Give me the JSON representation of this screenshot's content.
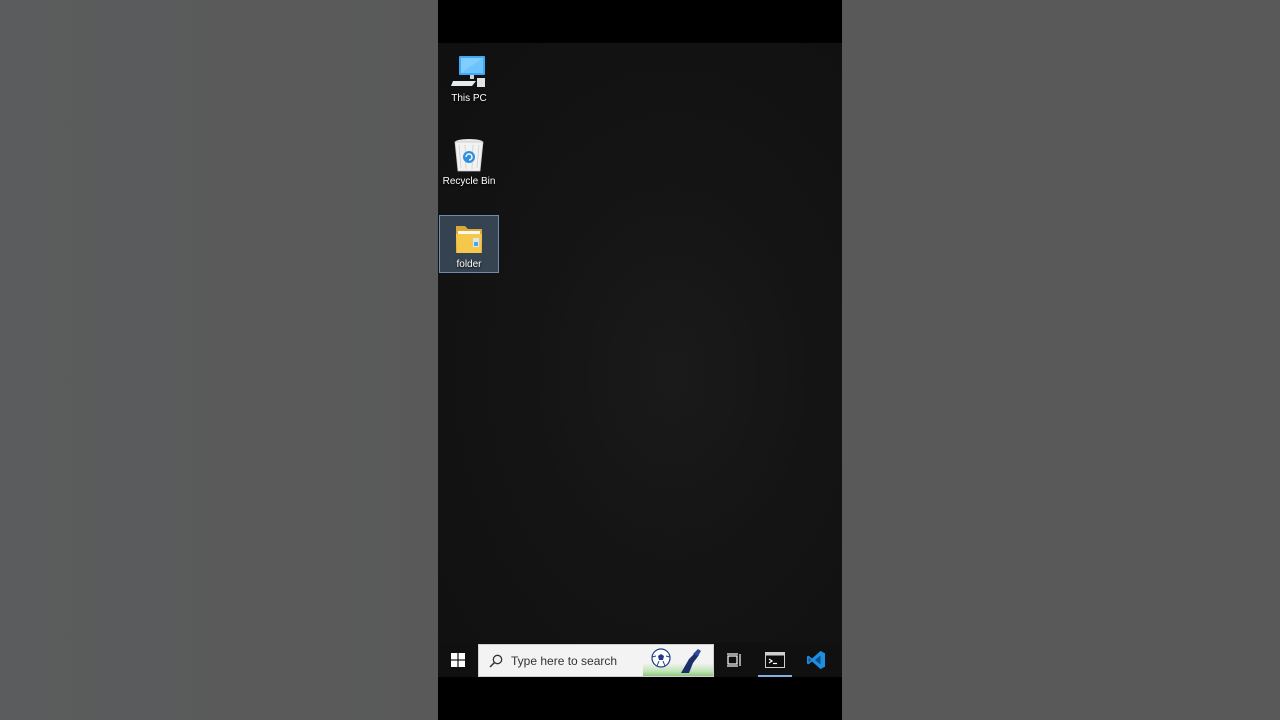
{
  "desktop": {
    "icons": [
      {
        "label": "This PC",
        "icon": "this-pc-icon"
      },
      {
        "label": "Recycle Bin",
        "icon": "recycle-bin-icon"
      },
      {
        "label": "folder",
        "icon": "folder-icon",
        "selected": true
      }
    ]
  },
  "taskbar": {
    "search": {
      "placeholder": "Type here to search",
      "value": ""
    },
    "buttons": [
      {
        "name": "start",
        "icon": "windows-logo-icon"
      },
      {
        "name": "task-view",
        "icon": "task-view-icon"
      },
      {
        "name": "terminal",
        "icon": "terminal-icon",
        "active": true
      },
      {
        "name": "vscode",
        "icon": "vscode-icon"
      }
    ],
    "accent_color": "#7fb2e5"
  },
  "colors": {
    "desktop_bg": "#141414",
    "taskbar_bg": "#101010",
    "letterbox": "#595959",
    "vscode_blue": "#1e8fe0",
    "folder_yellow": "#f5c84c"
  }
}
